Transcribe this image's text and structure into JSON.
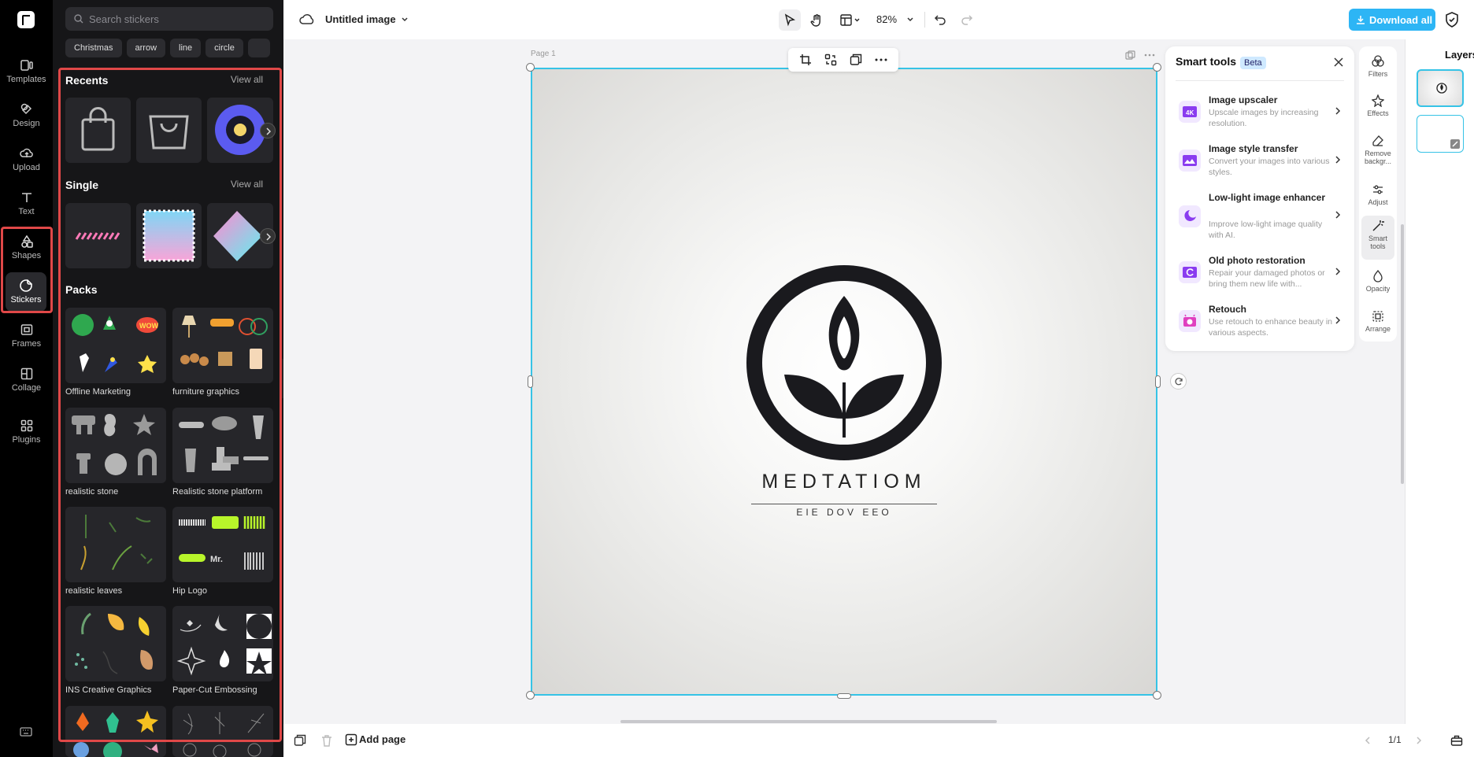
{
  "sidebar_nav": {
    "items": [
      {
        "label": "Templates",
        "icon": "templates-icon"
      },
      {
        "label": "Design",
        "icon": "design-icon"
      },
      {
        "label": "Upload",
        "icon": "upload-icon"
      },
      {
        "label": "Text",
        "icon": "text-icon"
      },
      {
        "label": "Shapes",
        "icon": "shapes-icon"
      },
      {
        "label": "Stickers",
        "icon": "stickers-icon"
      },
      {
        "label": "Frames",
        "icon": "frames-icon"
      },
      {
        "label": "Collage",
        "icon": "collage-icon"
      },
      {
        "label": "Plugins",
        "icon": "plugins-icon"
      }
    ],
    "active": "Stickers"
  },
  "stickers_panel": {
    "search_placeholder": "Search stickers",
    "chips": [
      "Christmas",
      "arrow",
      "line",
      "circle"
    ],
    "recents": {
      "title": "Recents",
      "view_all": "View all"
    },
    "single": {
      "title": "Single",
      "view_all": "View all"
    },
    "packs": {
      "title": "Packs",
      "items": [
        {
          "label": "Offline Marketing"
        },
        {
          "label": "furniture graphics"
        },
        {
          "label": "realistic stone"
        },
        {
          "label": "Realistic stone platform"
        },
        {
          "label": "realistic leaves"
        },
        {
          "label": "Hip Logo"
        },
        {
          "label": "INS Creative Graphics"
        },
        {
          "label": "Paper-Cut Embossing"
        }
      ]
    }
  },
  "topbar": {
    "title": "Untitled image",
    "zoom": "82%",
    "download": "Download all"
  },
  "canvas": {
    "page_label": "Page 1",
    "brand_text": "MEDTATIOM",
    "brand_subtext": "EIE DOV EEO"
  },
  "smart_tools": {
    "title": "Smart tools",
    "badge": "Beta",
    "items": [
      {
        "title": "Image upscaler",
        "desc": "Upscale images by increasing resolution."
      },
      {
        "title": "Image style transfer",
        "desc": "Convert your images into various styles."
      },
      {
        "title": "Low-light image enhancer",
        "desc": "Improve low-light image quality with AI."
      },
      {
        "title": "Old photo restoration",
        "desc": "Repair your damaged photos or bring them new life with..."
      },
      {
        "title": "Retouch",
        "desc": "Use retouch to enhance beauty in various aspects."
      }
    ]
  },
  "right_rail": {
    "items": [
      {
        "label": "Filters"
      },
      {
        "label": "Effects"
      },
      {
        "label": "Remove backgr..."
      },
      {
        "label": "Adjust"
      },
      {
        "label": "Smart tools"
      },
      {
        "label": "Opacity"
      },
      {
        "label": "Arrange"
      }
    ],
    "active": "Smart tools"
  },
  "layers": {
    "title": "Layers"
  },
  "bottombar": {
    "add_page": "Add page",
    "page_indicator": "1/1"
  },
  "colors": {
    "accent": "#2db5f5",
    "selection": "#36c3e6",
    "highlight": "#e04848",
    "panel_bg": "#161618"
  }
}
